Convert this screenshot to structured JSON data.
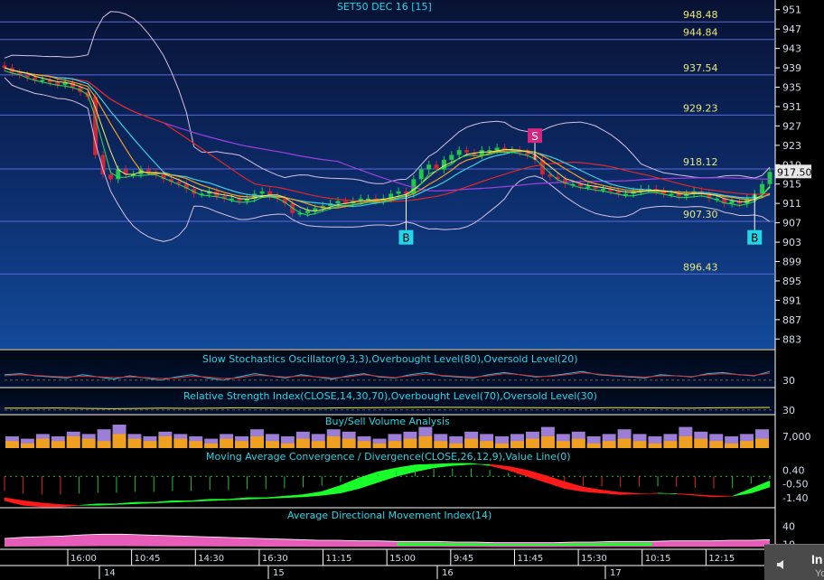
{
  "chart_data": [
    {
      "type": "line",
      "title": "SET50 DEC 16  [15]",
      "ylim": [
        881,
        953
      ],
      "y_ticks": [
        951,
        947,
        943,
        939,
        935,
        931,
        927,
        923,
        919,
        915,
        911,
        907,
        903,
        899,
        895,
        891,
        887,
        883
      ],
      "last_price": "917.50",
      "levels": [
        {
          "value": 948.48,
          "label": "948.48"
        },
        {
          "value": 944.84,
          "label": "944.84"
        },
        {
          "value": 937.54,
          "label": "937.54"
        },
        {
          "value": 929.23,
          "label": "929.23"
        },
        {
          "value": 918.12,
          "label": "918.12"
        },
        {
          "value": 907.3,
          "label": "907.30"
        },
        {
          "value": 896.43,
          "label": "896.43"
        }
      ],
      "signals": [
        {
          "label": "S",
          "x_index": 70,
          "price": 925
        },
        {
          "label": "B",
          "x_index": 53,
          "price": 904
        },
        {
          "label": "B",
          "x_index": 99,
          "price": 904
        }
      ],
      "close": [
        939,
        938,
        937.5,
        937,
        936.5,
        936.5,
        936,
        935.5,
        936,
        935,
        934,
        933,
        921,
        917,
        916,
        918,
        917,
        917,
        918,
        917.5,
        917,
        916,
        915.5,
        915,
        914,
        913,
        913,
        913.5,
        912.5,
        912,
        912,
        911.5,
        912,
        913,
        913.5,
        912.5,
        912,
        911,
        909,
        909,
        909.5,
        910,
        910.5,
        911,
        911.5,
        911,
        911.5,
        912,
        912,
        911.5,
        912,
        913,
        913.5,
        913,
        916,
        918,
        919,
        918,
        920,
        921,
        922,
        921.5,
        921,
        922,
        922,
        922.5,
        922,
        922,
        921.5,
        921,
        920,
        917,
        916.5,
        916,
        915,
        915,
        914.5,
        914.5,
        914,
        914,
        913.5,
        913,
        913,
        913.5,
        914,
        914,
        913.5,
        913,
        913,
        912.5,
        913,
        913.5,
        913,
        912,
        912,
        911,
        911.5,
        911,
        912,
        913,
        915,
        917.5
      ]
    },
    {
      "type": "line",
      "title": "Slow Stochastics Oscillator(9,3,3),Overbought Level(80),Oversold Level(20)",
      "ylim": [
        0,
        100
      ],
      "y_ticks": [
        30
      ],
      "series": [
        {
          "name": "%K",
          "values": [
            55,
            60,
            50,
            45,
            40,
            55,
            45,
            35,
            50,
            40,
            30,
            45,
            55,
            40,
            30,
            45,
            60,
            50,
            40,
            55,
            45,
            35,
            50,
            60,
            45,
            40,
            55,
            65,
            50,
            45,
            40,
            55,
            65,
            55,
            45,
            50,
            60,
            70,
            55,
            50,
            45,
            40,
            55,
            50,
            45,
            60,
            65,
            55,
            50,
            70
          ]
        },
        {
          "name": "%D",
          "values": [
            50,
            55,
            52,
            48,
            45,
            48,
            46,
            42,
            45,
            42,
            38,
            40,
            48,
            45,
            38,
            40,
            52,
            50,
            45,
            50,
            46,
            40,
            45,
            55,
            48,
            42,
            50,
            58,
            52,
            48,
            44,
            50,
            60,
            56,
            48,
            48,
            55,
            64,
            58,
            52,
            48,
            44,
            50,
            50,
            47,
            55,
            60,
            56,
            52,
            62
          ]
        }
      ]
    },
    {
      "type": "line",
      "title": "Relative Strength Index(CLOSE,14,30,70),Overbought Level(70),Oversold Level(30)",
      "ylim": [
        0,
        100
      ],
      "y_ticks": [
        30
      ],
      "series": [
        {
          "name": "RSI",
          "values": [
            45,
            44,
            46,
            43,
            40,
            42,
            44,
            43,
            45,
            47,
            46,
            44,
            45,
            47,
            48,
            50,
            52,
            51,
            50,
            49,
            48,
            47,
            46,
            48,
            47,
            46,
            45,
            47,
            48,
            50
          ]
        }
      ]
    },
    {
      "type": "bar",
      "title": "Buy/Sell Volume Analysis",
      "y_ticks": [
        "7,000"
      ],
      "series": [
        {
          "name": "Buy",
          "values": [
            3,
            2,
            4,
            3,
            5,
            4,
            3,
            6,
            4,
            3,
            5,
            4,
            3,
            2,
            4,
            3,
            5,
            3,
            2,
            4,
            3,
            5,
            4,
            3,
            2,
            3,
            4,
            5,
            3,
            2,
            4,
            3,
            2,
            3,
            4,
            5,
            3,
            4,
            2,
            3,
            4,
            3,
            2,
            3,
            5,
            4,
            3,
            2,
            3,
            4
          ]
        },
        {
          "name": "Sell",
          "values": [
            5,
            4,
            6,
            5,
            7,
            6,
            8,
            10,
            6,
            5,
            7,
            6,
            5,
            4,
            6,
            5,
            8,
            6,
            5,
            7,
            6,
            8,
            7,
            5,
            4,
            6,
            7,
            9,
            6,
            5,
            7,
            6,
            5,
            6,
            7,
            9,
            6,
            7,
            5,
            6,
            8,
            6,
            5,
            6,
            9,
            7,
            6,
            5,
            6,
            8
          ]
        }
      ]
    },
    {
      "type": "area",
      "title": "Moving Average Convergence / Divergence(CLOSE,26,12,9),Value Line(0)",
      "ylim": [
        -2.0,
        0.9
      ],
      "y_ticks": [
        "0.40",
        "-0.50",
        "-1.40"
      ],
      "series": [
        {
          "name": "MACD",
          "values": [
            -1.6,
            -1.9,
            -2.0,
            -2.0,
            -1.9,
            -1.8,
            -1.8,
            -1.7,
            -1.7,
            -1.6,
            -1.6,
            -1.5,
            -1.5,
            -1.4,
            -1.4,
            -1.3,
            -1.2,
            -1.0,
            -0.6,
            -0.1,
            0.3,
            0.55,
            0.75,
            0.8,
            0.85,
            0.85,
            0.7,
            0.4,
            0.0,
            -0.4,
            -0.8,
            -1.0,
            -1.1,
            -1.2,
            -1.15,
            -1.1,
            -1.15,
            -1.25,
            -1.35,
            -1.3,
            -0.8,
            -0.3
          ]
        },
        {
          "name": "Signal",
          "values": [
            -1.4,
            -1.6,
            -1.75,
            -1.85,
            -1.9,
            -1.9,
            -1.85,
            -1.8,
            -1.75,
            -1.7,
            -1.65,
            -1.6,
            -1.55,
            -1.5,
            -1.45,
            -1.4,
            -1.35,
            -1.25,
            -1.1,
            -0.8,
            -0.4,
            0.0,
            0.3,
            0.55,
            0.7,
            0.78,
            0.78,
            0.65,
            0.4,
            0.05,
            -0.35,
            -0.7,
            -0.9,
            -1.05,
            -1.12,
            -1.12,
            -1.13,
            -1.2,
            -1.28,
            -1.3,
            -1.1,
            -0.7
          ]
        }
      ]
    },
    {
      "type": "area",
      "title": "Average Directional Movement Index(14)",
      "ylim": [
        5,
        50
      ],
      "y_ticks": [
        "40",
        "10"
      ],
      "series": [
        {
          "name": "ADX",
          "values": [
            20,
            22,
            23,
            24,
            26,
            27,
            27,
            26,
            25,
            24,
            23,
            22,
            21,
            20,
            19,
            18,
            17,
            17,
            16,
            16,
            15,
            15,
            15,
            14,
            14,
            13,
            13,
            13,
            13,
            14,
            14,
            15,
            15,
            15,
            16,
            16,
            16,
            17,
            17,
            18
          ]
        }
      ]
    },
    {
      "type": "table",
      "x_time_labels": [
        "16:00",
        "10:45",
        "14:30",
        "16:30",
        "11:15",
        "15:00",
        "9:45",
        "11:45",
        "15:30",
        "10:15",
        "12:15",
        "16:"
      ],
      "x_date_labels": [
        "14",
        "15",
        "16",
        "17"
      ]
    }
  ],
  "colors": {
    "background": "#000000",
    "main_panel_top": "#0a1a44",
    "main_panel_bottom": "#103a80",
    "grid_line": "#5a6ad8",
    "title_text": "#22d6e8",
    "level_text": "#e8e87a",
    "bull_candle": "#23c84a",
    "bear_candle": "#c8263b",
    "macd_up": "#19ff2a",
    "macd_down": "#ff1a1a",
    "adx_fill": "#ff66cc",
    "vol_buy": "#f0a020",
    "vol_sell": "#9c7ed6",
    "signal_sell": "#d6267e",
    "signal_buy": "#22d6e8"
  },
  "widget": {
    "label": "In",
    "sub": "Yo",
    "icon": "speaker-icon"
  }
}
